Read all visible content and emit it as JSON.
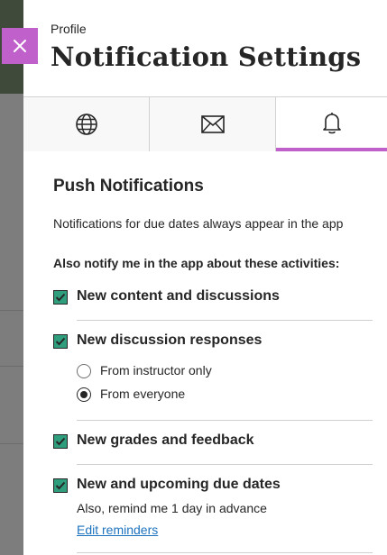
{
  "header": {
    "breadcrumb": "Profile",
    "title": "Notification Settings",
    "close_icon": "close-icon"
  },
  "tabs": [
    {
      "icon": "globe-icon",
      "selected": false
    },
    {
      "icon": "envelope-icon",
      "selected": false
    },
    {
      "icon": "bell-icon",
      "selected": true
    }
  ],
  "push": {
    "title": "Push Notifications",
    "intro": "Notifications for due dates always appear in the app",
    "subhead": "Also notify me in the app about these activities:",
    "options": [
      {
        "label": "New content and discussions",
        "checked": true
      },
      {
        "label": "New discussion responses",
        "checked": true,
        "radios": [
          {
            "label": "From instructor only",
            "checked": false
          },
          {
            "label": "From everyone",
            "checked": true
          }
        ]
      },
      {
        "label": "New grades and feedback",
        "checked": true
      },
      {
        "label": "New and upcoming due dates",
        "checked": true,
        "note": "Also, remind me 1 day in advance",
        "link": "Edit reminders"
      }
    ]
  },
  "colors": {
    "accent": "#c061cb",
    "checkbox": "#2e9e7d",
    "link": "#1e73be"
  }
}
